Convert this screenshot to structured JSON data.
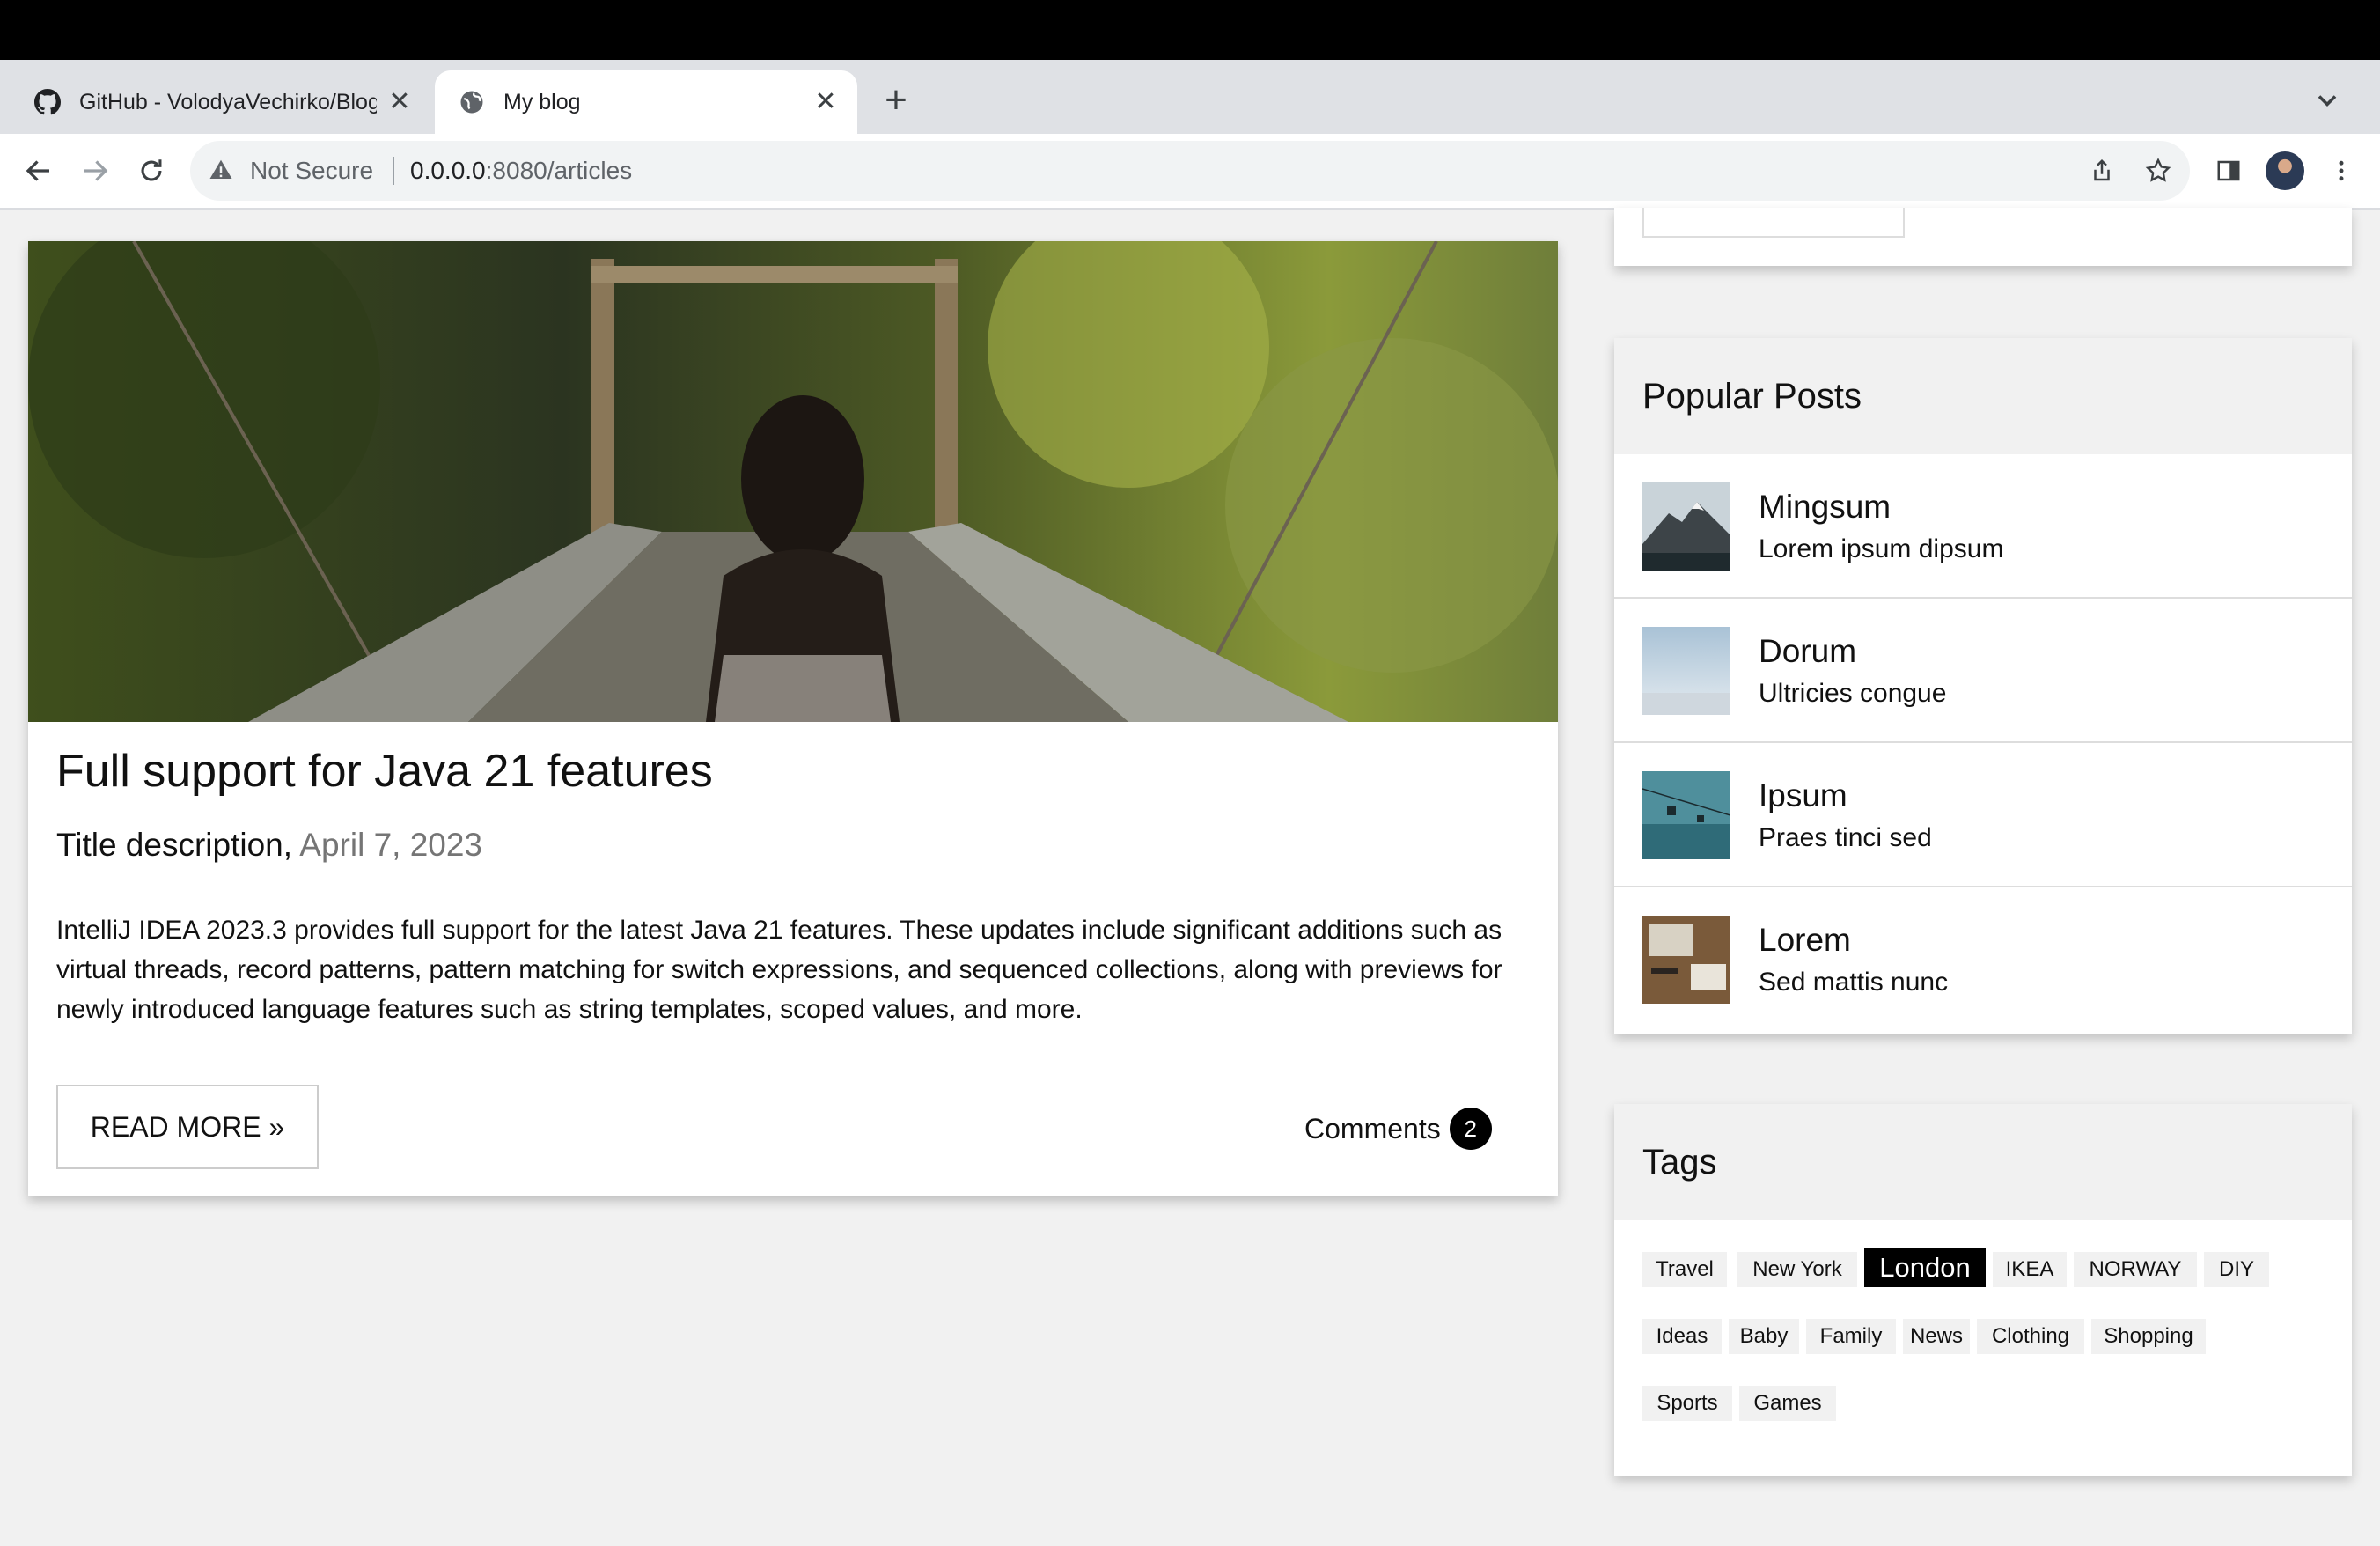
{
  "browser": {
    "tabs": [
      {
        "title": "GitHub - VolodyaVechirko/Blog",
        "favicon": "github-icon"
      },
      {
        "title": "My blog",
        "favicon": "globe-icon"
      }
    ],
    "close_glyph": "✕",
    "new_tab_glyph": "+",
    "security_label": "Not Secure",
    "url_host": "0.0.0.0",
    "url_rest": ":8080/articles"
  },
  "article": {
    "title": "Full support for Java 21 features",
    "subtitle": "Title description,",
    "date": "April 7, 2023",
    "body": "IntelliJ IDEA 2023.3 provides full support for the latest Java 21 features. These updates include significant additions such as virtual threads, record patterns, pattern matching for switch expressions, and sequenced collections, along with previews for newly introduced language features such as string templates, scoped values, and more.",
    "read_more": "READ MORE »",
    "comments_label": "Comments",
    "comments_count": "2"
  },
  "popular": {
    "heading": "Popular Posts",
    "posts": [
      {
        "title": "Mingsum",
        "desc": "Lorem ipsum dipsum"
      },
      {
        "title": "Dorum",
        "desc": "Ultricies congue"
      },
      {
        "title": "Ipsum",
        "desc": "Praes tinci sed"
      },
      {
        "title": "Lorem",
        "desc": "Sed mattis nunc"
      }
    ]
  },
  "tags": {
    "heading": "Tags",
    "items": [
      "Travel",
      "New York",
      "London",
      "IKEA",
      "NORWAY",
      "DIY",
      "Ideas",
      "Baby",
      "Family",
      "News",
      "Clothing",
      "Shopping",
      "Sports",
      "Games"
    ],
    "active": "London"
  },
  "colors": {
    "page_bg": "#f1f1f1",
    "card_head_bg": "#f1f1f1",
    "tag_active_bg": "#000000"
  }
}
